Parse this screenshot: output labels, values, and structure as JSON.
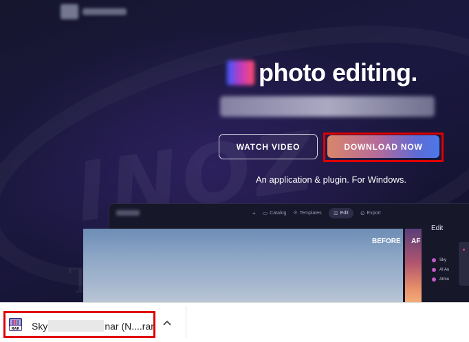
{
  "hero": {
    "headline": "photo editing.",
    "cta_watch": "WATCH VIDEO",
    "cta_download": "DOWNLOAD NOW",
    "tagline": "An application & plugin. For Windows."
  },
  "app_preview": {
    "toolbar": {
      "plus": "+",
      "catalog": "Catalog",
      "templates": "Templates",
      "edit": "Edit",
      "export": "Export"
    },
    "before_label": "BEFORE",
    "after_label": "AF",
    "panel_title": "Edit",
    "panel_items": [
      "Sky",
      "AI Au",
      "Atmo"
    ]
  },
  "download_bar": {
    "file_prefix": "Sky",
    "file_suffix": "nar (N....rar",
    "icon": "rar-archive-icon",
    "menu_icon": "chevron-up-icon"
  },
  "colors": {
    "highlight": "#e00000",
    "download_gradient_start": "#d9866a",
    "download_gradient_end": "#4b78e8",
    "hero_background": "#16162e"
  }
}
